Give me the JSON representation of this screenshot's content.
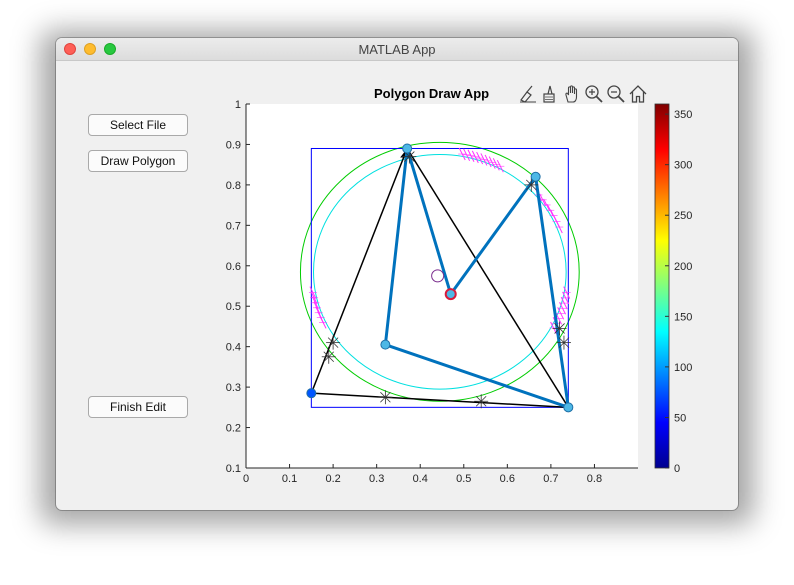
{
  "window": {
    "title": "MATLAB App"
  },
  "buttons": {
    "select_file": "Select File",
    "draw_polygon": "Draw Polygon",
    "finish_edit": "Finish Edit"
  },
  "axes": {
    "title": "Polygon Draw App",
    "x_ticks": [
      "0",
      "0.1",
      "0.2",
      "0.3",
      "0.4",
      "0.5",
      "0.6",
      "0.7",
      "0.8"
    ],
    "y_ticks": [
      "0.1",
      "0.2",
      "0.3",
      "0.4",
      "0.5",
      "0.6",
      "0.7",
      "0.8",
      "0.9",
      "1"
    ]
  },
  "colorbar": {
    "ticks": [
      "0",
      "50",
      "100",
      "150",
      "200",
      "250",
      "300",
      "350"
    ],
    "range": [
      0,
      360
    ]
  },
  "toolbar_icons": [
    "brush-icon",
    "data-tips-icon",
    "pan-icon",
    "zoom-in-icon",
    "zoom-out-icon",
    "home-icon"
  ],
  "chart_data": {
    "type": "line",
    "title": "Polygon Draw App",
    "xlim": [
      0,
      0.9
    ],
    "ylim": [
      0.1,
      1
    ],
    "grid": false,
    "series": [
      {
        "kind": "black-triangle",
        "points": [
          [
            0.15,
            0.285
          ],
          [
            0.37,
            0.89
          ],
          [
            0.74,
            0.25
          ],
          [
            0.15,
            0.285
          ]
        ]
      },
      {
        "kind": "blue-polygon",
        "points": [
          [
            0.37,
            0.89
          ],
          [
            0.47,
            0.53
          ],
          [
            0.665,
            0.82
          ],
          [
            0.74,
            0.25
          ],
          [
            0.32,
            0.405
          ],
          [
            0.37,
            0.89
          ]
        ]
      },
      {
        "kind": "bounding-box",
        "rect": [
          0.15,
          0.25,
          0.74,
          0.89
        ]
      },
      {
        "kind": "green-circle",
        "center": [
          0.445,
          0.585
        ],
        "radius": 0.32
      },
      {
        "kind": "cyan-circle",
        "center": [
          0.445,
          0.585
        ],
        "radius": 0.29
      }
    ],
    "star_markers": [
      [
        0.375,
        0.87
      ],
      [
        0.2,
        0.41
      ],
      [
        0.19,
        0.375
      ],
      [
        0.32,
        0.275
      ],
      [
        0.54,
        0.265
      ],
      [
        0.655,
        0.8
      ],
      [
        0.72,
        0.445
      ],
      [
        0.73,
        0.41
      ]
    ],
    "vertex_markers": [
      [
        0.15,
        0.285
      ],
      [
        0.37,
        0.89
      ],
      [
        0.665,
        0.82
      ],
      [
        0.74,
        0.25
      ],
      [
        0.32,
        0.405
      ],
      [
        0.47,
        0.53
      ]
    ],
    "small_circle": [
      0.44,
      0.575
    ],
    "colors": {
      "polygon": "#0072bd",
      "green_circle": "#00cc00",
      "cyan_circle": "#00e0e0",
      "box": "#0000ff",
      "hatch": "#ff33ff",
      "vertex": "#4db8e6",
      "center_vertex": "#d81b3c"
    }
  }
}
